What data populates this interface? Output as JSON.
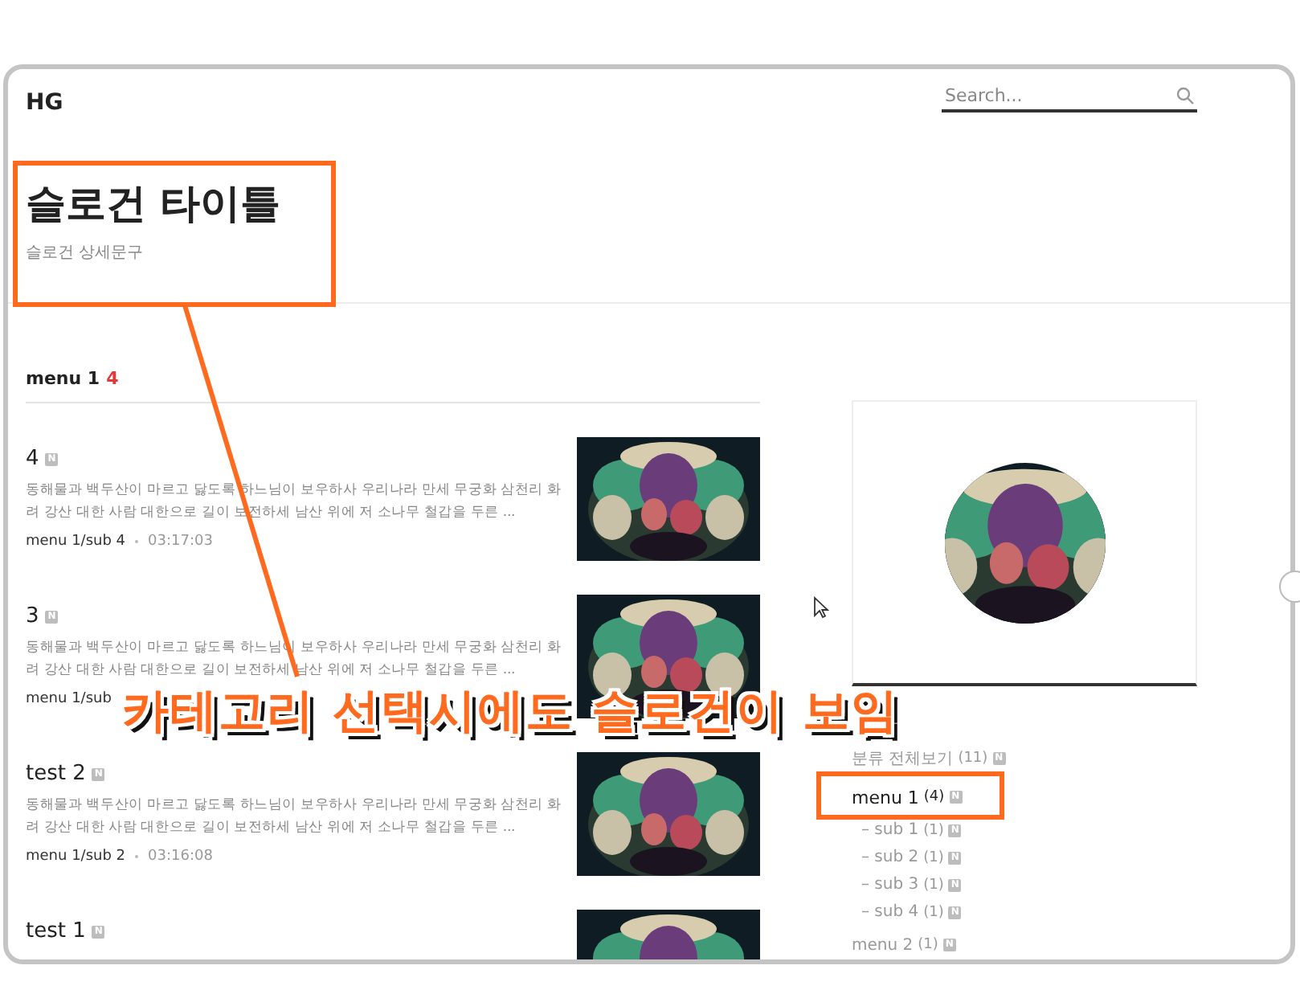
{
  "header": {
    "logo": "HG",
    "search": {
      "placeholder": "Search..."
    }
  },
  "slogan": {
    "title": "슬로건 타이틀",
    "subtitle": "슬로건 상세문구"
  },
  "category_heading": {
    "name": "menu 1",
    "count": "4"
  },
  "posts": [
    {
      "title": "4",
      "badge": "N",
      "excerpt": "동해물과 백두산이 마르고 닳도록 하느님이 보우하사 우리나라 만세 무궁화 삼천리 화려 강산 대한 사람 대한으로 길이 보전하세 남산 위에 저 소나무 철갑을 두른 ...",
      "category": "menu 1/sub 4",
      "time": "03:17:03"
    },
    {
      "title": "3",
      "badge": "N",
      "excerpt": "동해물과 백두산이 마르고 닳도록 하느님이 보우하사 우리나라 만세 무궁화 삼천리 화려 강산 대한 사람 대한으로 길이 보전하세 남산 위에 저 소나무 철갑을 두른 ...",
      "category": "menu 1/sub"
    },
    {
      "title": "test 2",
      "badge": "N",
      "excerpt": "동해물과 백두산이 마르고 닳도록 하느님이 보우하사 우리나라 만세 무궁화 삼천리 화려 강산 대한 사람 대한으로 길이 보전하세 남산 위에 저 소나무 철갑을 두른 ...",
      "category": "menu 1/sub 2",
      "time": "03:16:08"
    },
    {
      "title": "test 1",
      "badge": "N"
    }
  ],
  "sidebar": {
    "categories": [
      {
        "label": "분류 전체보기",
        "count": "(11)",
        "badge": "N",
        "selected": false
      },
      {
        "label": "menu 1",
        "count": "(4)",
        "badge": "N",
        "selected": true,
        "children": [
          {
            "label": "– sub 1",
            "count": "(1)",
            "badge": "N",
            "selected": false
          },
          {
            "label": "– sub 2",
            "count": "(1)",
            "badge": "N",
            "selected": false
          },
          {
            "label": "– sub 3",
            "count": "(1)",
            "badge": "N",
            "selected": false
          },
          {
            "label": "– sub 4",
            "count": "(1)",
            "badge": "N",
            "selected": false
          }
        ]
      },
      {
        "label": "menu 2",
        "count": "(1)",
        "badge": "N",
        "selected": false
      }
    ]
  },
  "annotation": {
    "caption": "카테고리 선택시에도 슬로건이 보임"
  }
}
